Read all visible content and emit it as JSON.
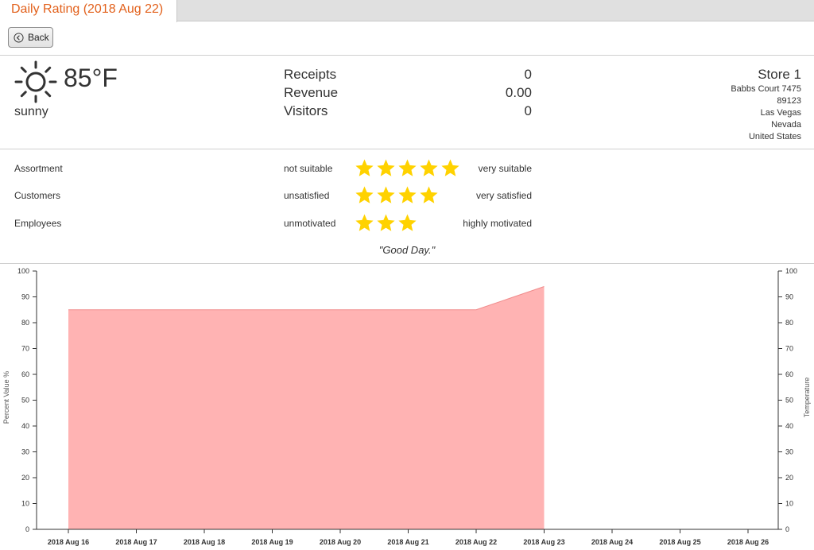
{
  "tab": {
    "title": "Daily Rating (2018 Aug 22)"
  },
  "toolbar": {
    "back_label": "Back"
  },
  "weather": {
    "icon": "sun-icon",
    "temperature": "85°F",
    "condition": "sunny"
  },
  "stats": [
    {
      "label": "Receipts",
      "value": "0"
    },
    {
      "label": "Revenue",
      "value": "0.00"
    },
    {
      "label": "Visitors",
      "value": "0"
    }
  ],
  "store": {
    "name": "Store 1",
    "address": [
      "Babbs Court 7475",
      "89123",
      "Las Vegas",
      "Nevada",
      "United States"
    ]
  },
  "ratings": [
    {
      "label": "Assortment",
      "low": "not suitable",
      "high": "very suitable",
      "stars": 5
    },
    {
      "label": "Customers",
      "low": "unsatisfied",
      "high": "very satisfied",
      "stars": 4
    },
    {
      "label": "Employees",
      "low": "unmotivated",
      "high": "highly motivated",
      "stars": 3
    }
  ],
  "star_color": "#ffd200",
  "comment": "\"Good Day.\"",
  "chart_data": {
    "type": "area",
    "categories": [
      "2018 Aug 16",
      "2018 Aug 17",
      "2018 Aug 18",
      "2018 Aug 19",
      "2018 Aug 20",
      "2018 Aug 21",
      "2018 Aug 22",
      "2018 Aug 23",
      "2018 Aug 24",
      "2018 Aug 25",
      "2018 Aug 26"
    ],
    "series": [
      {
        "values": [
          85,
          85,
          85,
          85,
          85,
          85,
          85,
          94,
          null,
          null,
          null
        ],
        "color": "#ffb3b3"
      }
    ],
    "ylabel_left": "Percent Value %",
    "ylabel_right": "Temperature",
    "ylim": [
      0,
      100
    ],
    "yticks": [
      0,
      10,
      20,
      30,
      40,
      50,
      60,
      70,
      80,
      90,
      100
    ],
    "grid": false
  }
}
